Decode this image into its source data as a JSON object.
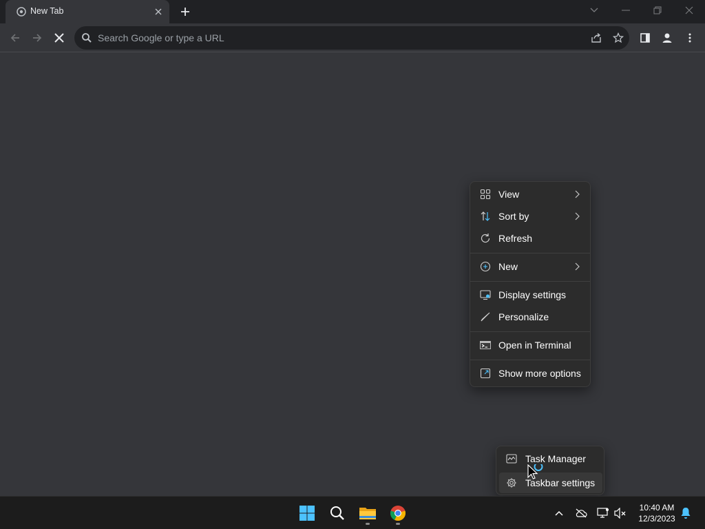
{
  "browser": {
    "tab": {
      "title": "New Tab"
    },
    "omnibox": {
      "placeholder": "Search Google or type a URL"
    }
  },
  "context_menu": {
    "items": [
      {
        "label": "View",
        "icon": "grid-icon",
        "submenu": true
      },
      {
        "label": "Sort by",
        "icon": "sort-icon",
        "submenu": true
      },
      {
        "label": "Refresh",
        "icon": "refresh-icon",
        "submenu": false
      },
      {
        "label": "New",
        "icon": "plus-circle-icon",
        "submenu": true
      },
      {
        "label": "Display settings",
        "icon": "display-icon",
        "submenu": false
      },
      {
        "label": "Personalize",
        "icon": "brush-icon",
        "submenu": false
      },
      {
        "label": "Open in Terminal",
        "icon": "terminal-icon",
        "submenu": false
      },
      {
        "label": "Show more options",
        "icon": "external-icon",
        "submenu": false
      }
    ]
  },
  "taskbar_menu": {
    "items": [
      {
        "label": "Task Manager",
        "icon": "task-manager-icon"
      },
      {
        "label": "Taskbar settings",
        "icon": "gear-icon"
      }
    ]
  },
  "taskbar": {
    "apps": [
      "start-icon",
      "search-icon",
      "file-explorer-icon",
      "chrome-icon"
    ],
    "clock": {
      "time": "10:40 AM",
      "date": "12/3/2023"
    }
  },
  "colors": {
    "accent": "#4cc2ff",
    "background": "#35363a",
    "taskbar": "#1c1c1c"
  }
}
